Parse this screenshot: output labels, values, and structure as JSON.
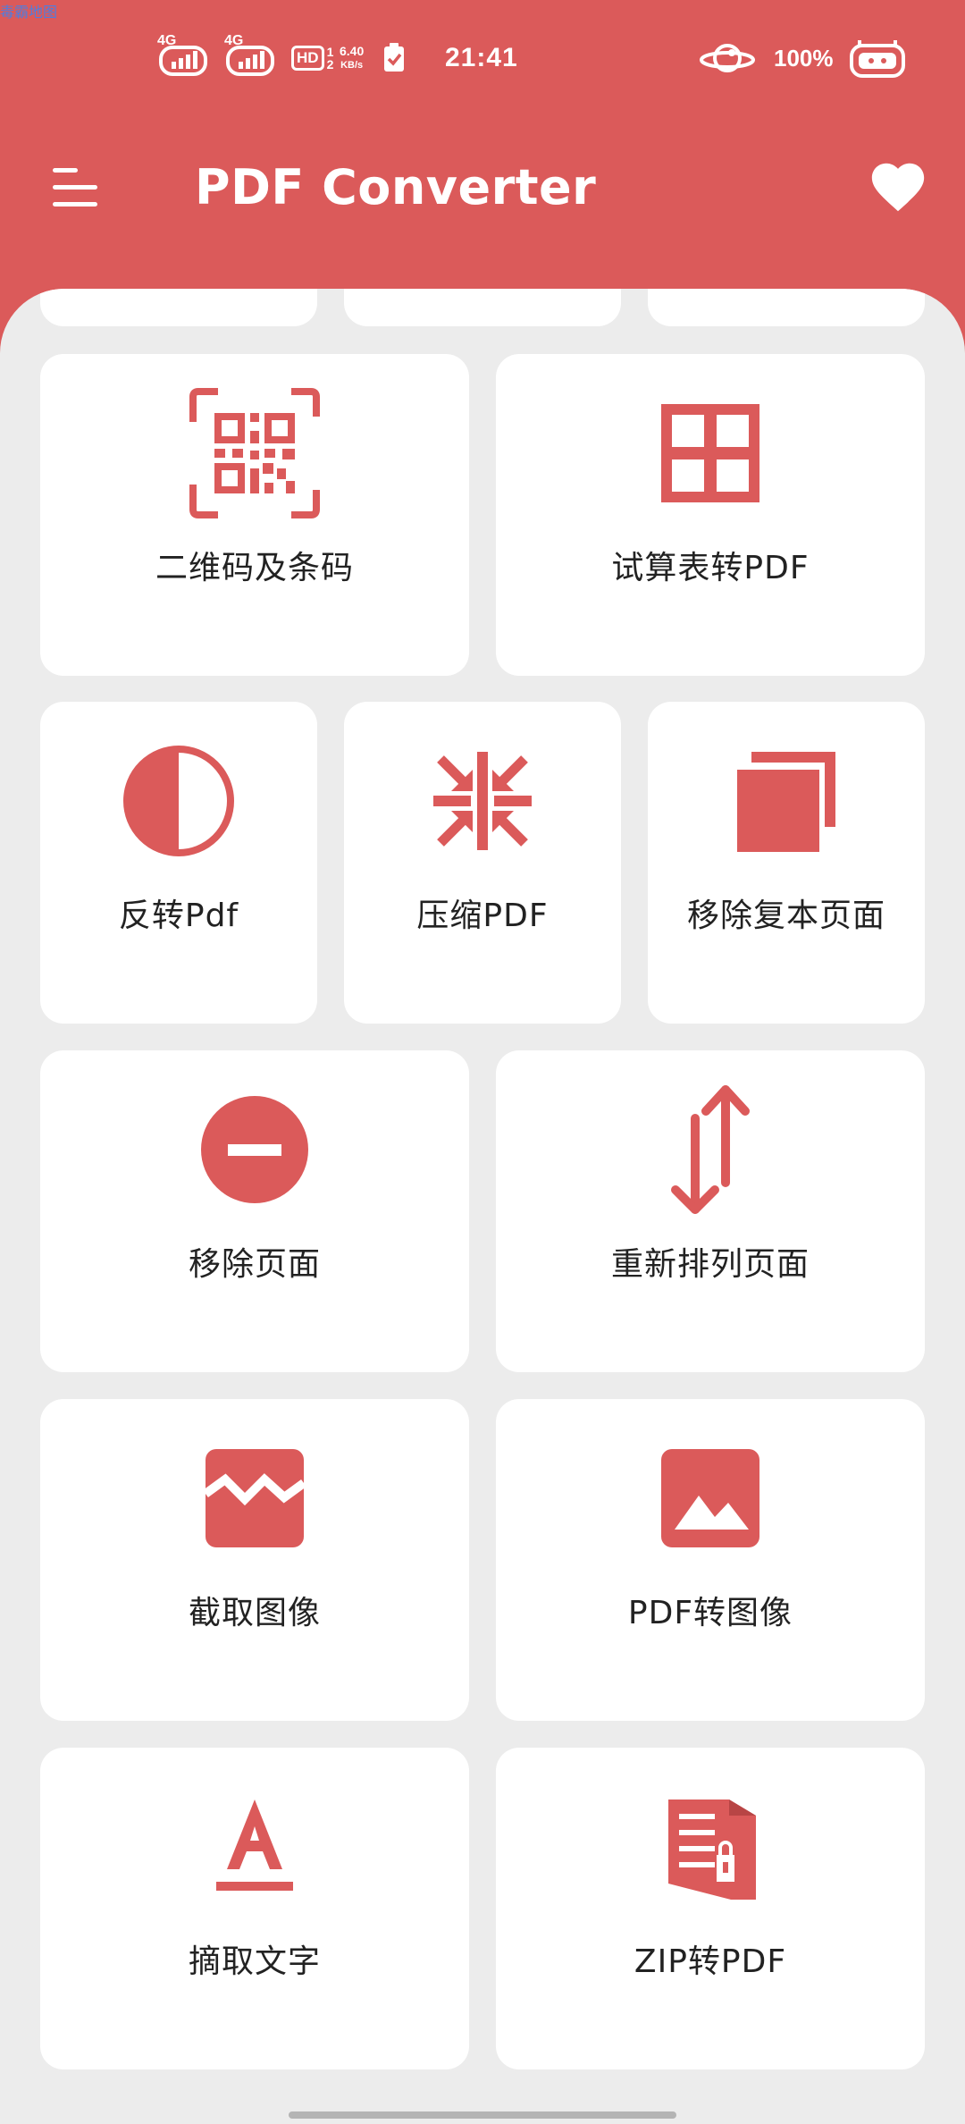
{
  "status_bar": {
    "signal1_label": "4G",
    "signal2_label": "4G",
    "hd_label": "HD",
    "sim_numbers": "1 2",
    "net_speed_value": "6.40",
    "net_speed_unit": "KB/s",
    "time": "21:41",
    "battery_percent": "100%"
  },
  "app_bar": {
    "title": "PDF Converter"
  },
  "grid": {
    "cards": [
      {
        "label": "二维码及条码",
        "icon": "qr-code-icon"
      },
      {
        "label": "试算表转PDF",
        "icon": "spreadsheet-grid-icon"
      },
      {
        "label": "反转Pdf",
        "icon": "invert-contrast-icon"
      },
      {
        "label": "压缩PDF",
        "icon": "compress-arrows-icon"
      },
      {
        "label": "移除复本页面",
        "icon": "duplicate-pages-icon"
      },
      {
        "label": "移除页面",
        "icon": "remove-circle-icon"
      },
      {
        "label": "重新排列页面",
        "icon": "swap-vertical-icon"
      },
      {
        "label": "截取图像",
        "icon": "broken-image-icon"
      },
      {
        "label": "PDF转图像",
        "icon": "image-icon"
      },
      {
        "label": "摘取文字",
        "icon": "text-format-icon"
      },
      {
        "label": "ZIP转PDF",
        "icon": "zip-archive-icon"
      }
    ]
  },
  "colors": {
    "accent": "#db5a5a",
    "background": "#ececec",
    "card": "#ffffff",
    "text": "#222222"
  }
}
